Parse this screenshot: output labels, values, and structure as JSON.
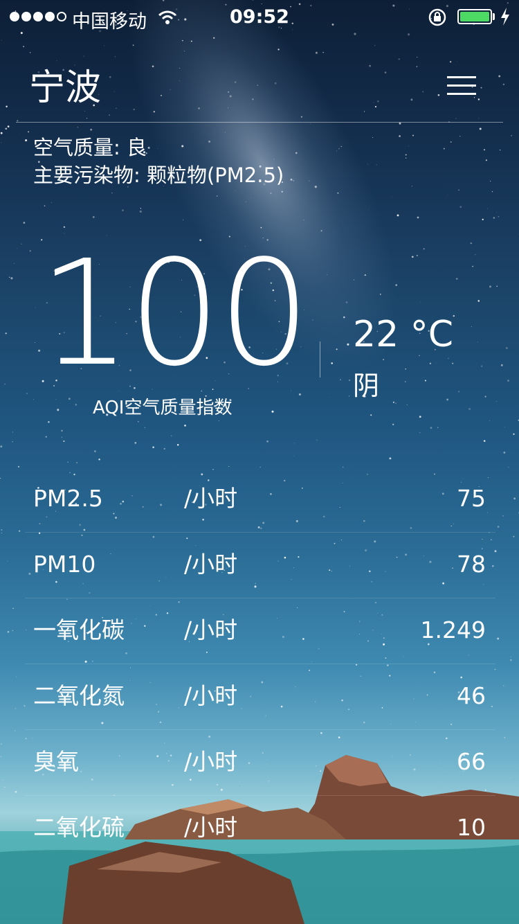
{
  "status_bar": {
    "carrier": "中国移动",
    "time": "09:52",
    "battery_level": 1.0
  },
  "header": {
    "city": "宁波"
  },
  "quality": {
    "level_text": "空气质量: 良",
    "main_pollutant_text": "主要污染物: 颗粒物(PM2.5)"
  },
  "aqi": {
    "value": "100",
    "label": "AQI空气质量指数"
  },
  "weather": {
    "temperature": "22  °C",
    "condition": "阴"
  },
  "pollutants": [
    {
      "name": "PM2.5",
      "unit": "/小时",
      "value": "75"
    },
    {
      "name": "PM10",
      "unit": "/小时",
      "value": "78"
    },
    {
      "name": "一氧化碳",
      "unit": "/小时",
      "value": "1.249"
    },
    {
      "name": "二氧化氮",
      "unit": "/小时",
      "value": "46"
    },
    {
      "name": "臭氧",
      "unit": "/小时",
      "value": "66"
    },
    {
      "name": "二氧化硫",
      "unit": "/小时",
      "value": "10"
    }
  ],
  "colors": {
    "battery_fill": "#4cd964",
    "text": "#ffffff"
  },
  "icons": [
    "wifi-icon",
    "rotation-lock-icon",
    "battery-icon",
    "charging-bolt-icon",
    "menu-icon"
  ]
}
